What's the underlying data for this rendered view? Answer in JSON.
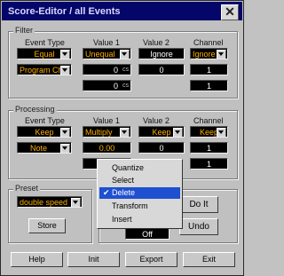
{
  "window": {
    "title": "Score-Editor / all Events",
    "close_glyph": "✕"
  },
  "filter": {
    "label": "Filter",
    "headers": [
      "Event Type",
      "Value 1",
      "Value 2",
      "Channel"
    ],
    "row1": [
      "Equal",
      "Unequal",
      "Ignore",
      "Ignore"
    ],
    "row2": [
      "Program Char",
      "0",
      "0",
      "1"
    ],
    "row3": [
      "0",
      "1"
    ],
    "unit_cs": "cs"
  },
  "processing": {
    "label": "Processing",
    "headers": [
      "Event Type",
      "Value 1",
      "Value 2",
      "Channel"
    ],
    "row1": [
      "Keep",
      "Multiply",
      "Keep",
      "Keep"
    ],
    "row2": [
      "Note",
      "0.00",
      "0",
      "1"
    ],
    "row3": [
      "0",
      "1"
    ]
  },
  "preset": {
    "label": "Preset",
    "selected": "double speed",
    "store_label": "Store"
  },
  "function": {
    "label": "F",
    "do_it_label": "Do It",
    "undo_label": "Undo",
    "partial_value": "Off"
  },
  "menu": {
    "items": [
      "Quantize",
      "Select",
      "Delete",
      "Transform",
      "Insert"
    ],
    "selected_index": 2,
    "check_glyph": "✔"
  },
  "footer": {
    "help": "Help",
    "init": "Init",
    "export": "Export",
    "exit": "Exit"
  },
  "colors": {
    "title_bg": "#05066a",
    "field_text": "#ffb000",
    "menu_highlight": "#1e50d0"
  }
}
